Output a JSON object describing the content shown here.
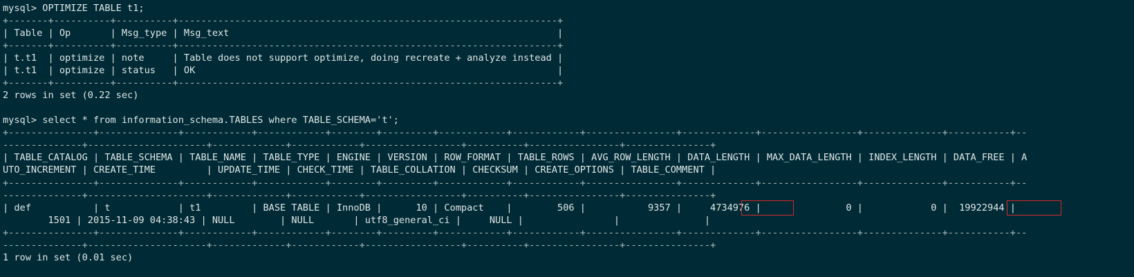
{
  "terminal": {
    "lines": [
      "mysql> OPTIMIZE TABLE t1;",
      "+-------+----------+----------+-------------------------------------------------------------------+",
      "| Table | Op       | Msg_type | Msg_text                                                          |",
      "+-------+----------+----------+-------------------------------------------------------------------+",
      "| t.t1  | optimize | note     | Table does not support optimize, doing recreate + analyze instead |",
      "| t.t1  | optimize | status   | OK                                                                |",
      "+-------+----------+----------+-------------------------------------------------------------------+",
      "2 rows in set (0.22 sec)",
      "",
      "mysql> select * from information_schema.TABLES where TABLE_SCHEMA='t';",
      "+---------------+--------------+------------+------------+--------+---------+------------+------------+----------------+-------------+-----------------+--------------+-----------+--",
      "--------------+---------------------+-------------+------------+-----------------+----------+----------------+---------------+",
      "| TABLE_CATALOG | TABLE_SCHEMA | TABLE_NAME | TABLE_TYPE | ENGINE | VERSION | ROW_FORMAT | TABLE_ROWS | AVG_ROW_LENGTH | DATA_LENGTH | MAX_DATA_LENGTH | INDEX_LENGTH | DATA_FREE | A",
      "UTO_INCREMENT | CREATE_TIME         | UPDATE_TIME | CHECK_TIME | TABLE_COLLATION | CHECKSUM | CREATE_OPTIONS | TABLE_COMMENT |",
      "+---------------+--------------+------------+------------+--------+---------+------------+------------+----------------+-------------+-----------------+--------------+-----------+--",
      "--------------+---------------------+-------------+------------+-----------------+----------+----------------+---------------+",
      "| def           | t            | t1         | BASE TABLE | InnoDB |      10 | Compact    |        506 |           9357 |     4734976 |               0 |            0 |  19922944 |",
      "        1501 | 2015-11-09 04:38:43 | NULL        | NULL       | utf8_general_ci |     NULL |                |               |",
      "+---------------+--------------+------------+------------+--------+---------+------------+------------+----------------+-------------+-----------------+--------------+-----------+--",
      "--------------+---------------------+-------------+------------+-----------------+----------+----------------+---------------+",
      "1 row in set (0.01 sec)"
    ],
    "highlights": [
      "4734976",
      "19922944"
    ],
    "colors": {
      "background": "#002b36",
      "text": "#e0e6e6",
      "highlight": "#d42a2a"
    }
  }
}
